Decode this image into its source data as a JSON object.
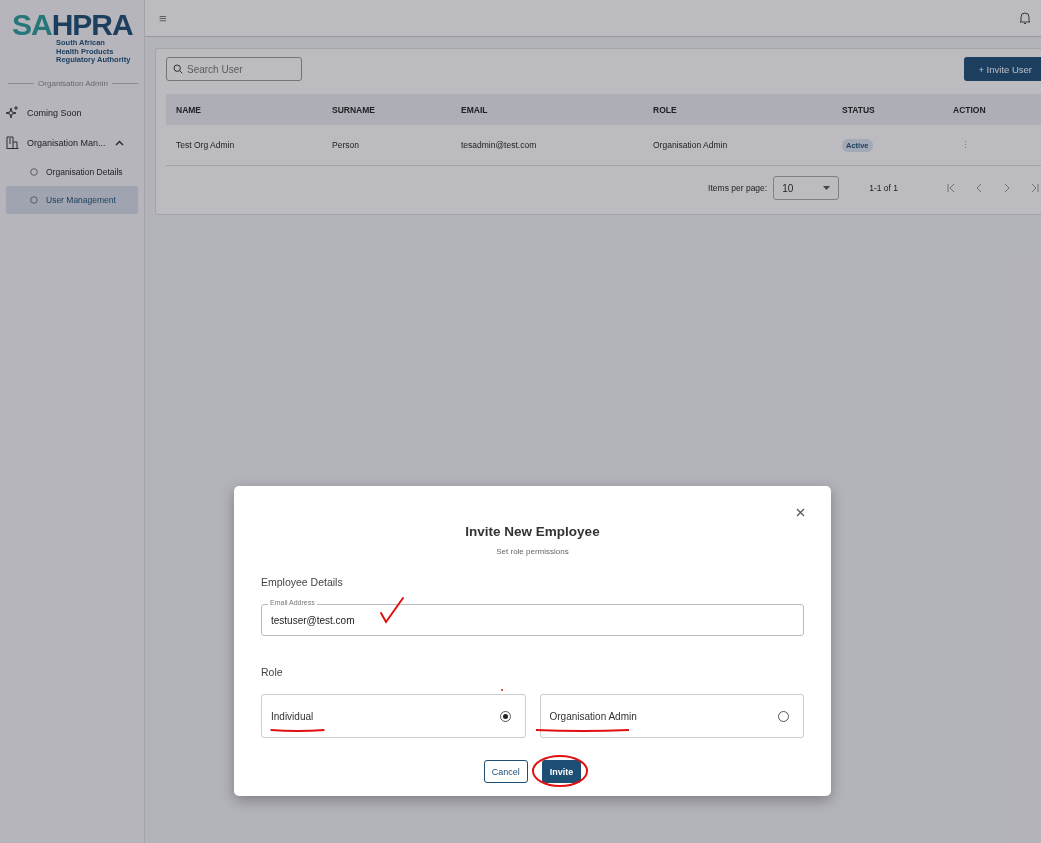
{
  "logo": {
    "lead": "SA",
    "rest": "HPRA",
    "tagline": "South African\nHealth Products\nRegulatory Authority"
  },
  "sidebar": {
    "section": "Organisation Admin",
    "items": [
      {
        "label": "Coming Soon",
        "selected": false
      },
      {
        "label": "Organisation Man...",
        "expanded": true,
        "selected": false,
        "children": [
          {
            "label": "Organisation Details",
            "selected": false
          },
          {
            "label": "User Management",
            "selected": true
          }
        ]
      }
    ]
  },
  "topbar": {
    "menu": "≡"
  },
  "search": {
    "placeholder": "Search User"
  },
  "invite_button": "+ Invite User",
  "table": {
    "columns": [
      "NAME",
      "SURNAME",
      "EMAIL",
      "ROLE",
      "STATUS",
      "ACTION"
    ],
    "rows": [
      {
        "name": "Test Org Admin",
        "surname": "Person",
        "email": "tesadmin@test.com",
        "role": "Organisation Admin",
        "status": "Active",
        "action": "⋮"
      }
    ]
  },
  "pagination": {
    "label": "Items per page:",
    "page_size": "10",
    "range": "1-1 of 1"
  },
  "dialog": {
    "title": "Invite New Employee",
    "subtitle": "Set role permissions",
    "section": "Employee Details",
    "email": {
      "label": "Email Address",
      "value": "testuser@test.com"
    },
    "role_heading": "Role",
    "roles": [
      {
        "label": "Individual",
        "selected": true
      },
      {
        "label": "Organisation Admin",
        "selected": false
      }
    ],
    "buttons": [
      {
        "label": "Cancel",
        "kind": "secondary"
      },
      {
        "label": "Invite",
        "kind": "primary"
      }
    ]
  }
}
